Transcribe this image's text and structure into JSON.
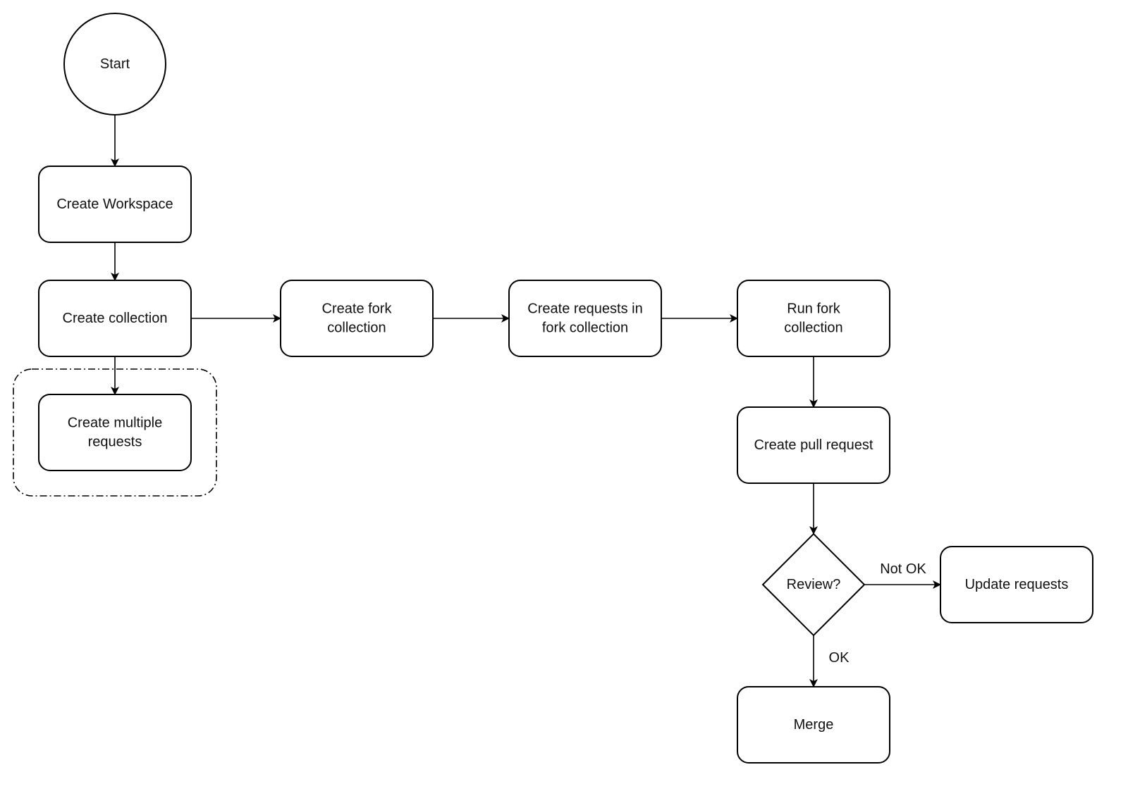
{
  "diagram": {
    "type": "flowchart",
    "nodes": [
      {
        "id": "start",
        "shape": "circle",
        "label": [
          "Start"
        ]
      },
      {
        "id": "create-workspace",
        "shape": "rounded-rect",
        "label": [
          "Create Workspace"
        ]
      },
      {
        "id": "create-collection",
        "shape": "rounded-rect",
        "label": [
          "Create collection"
        ]
      },
      {
        "id": "create-multiple-requests",
        "shape": "rounded-rect",
        "label": [
          "Create multiple",
          "requests"
        ]
      },
      {
        "id": "create-fork-collection",
        "shape": "rounded-rect",
        "label": [
          "Create fork",
          "collection"
        ]
      },
      {
        "id": "create-requests-in-fork",
        "shape": "rounded-rect",
        "label": [
          "Create requests in",
          "fork collection"
        ]
      },
      {
        "id": "run-fork-collection",
        "shape": "rounded-rect",
        "label": [
          "Run fork",
          "collection"
        ]
      },
      {
        "id": "create-pull-request",
        "shape": "rounded-rect",
        "label": [
          "Create pull request"
        ]
      },
      {
        "id": "review",
        "shape": "diamond",
        "label": [
          "Review?"
        ]
      },
      {
        "id": "update-requests",
        "shape": "rounded-rect",
        "label": [
          "Update requests"
        ]
      },
      {
        "id": "merge",
        "shape": "rounded-rect",
        "label": [
          "Merge"
        ]
      }
    ],
    "groups": [
      {
        "id": "requests-group",
        "style": "dash-dot",
        "contains": [
          "create-multiple-requests"
        ]
      }
    ],
    "edges": [
      {
        "from": "start",
        "to": "create-workspace",
        "label": ""
      },
      {
        "from": "create-workspace",
        "to": "create-collection",
        "label": ""
      },
      {
        "from": "create-collection",
        "to": "create-multiple-requests",
        "label": ""
      },
      {
        "from": "create-collection",
        "to": "create-fork-collection",
        "label": ""
      },
      {
        "from": "create-fork-collection",
        "to": "create-requests-in-fork",
        "label": ""
      },
      {
        "from": "create-requests-in-fork",
        "to": "run-fork-collection",
        "label": ""
      },
      {
        "from": "run-fork-collection",
        "to": "create-pull-request",
        "label": ""
      },
      {
        "from": "create-pull-request",
        "to": "review",
        "label": ""
      },
      {
        "from": "review",
        "to": "update-requests",
        "label": "Not OK"
      },
      {
        "from": "review",
        "to": "merge",
        "label": "OK"
      }
    ]
  }
}
